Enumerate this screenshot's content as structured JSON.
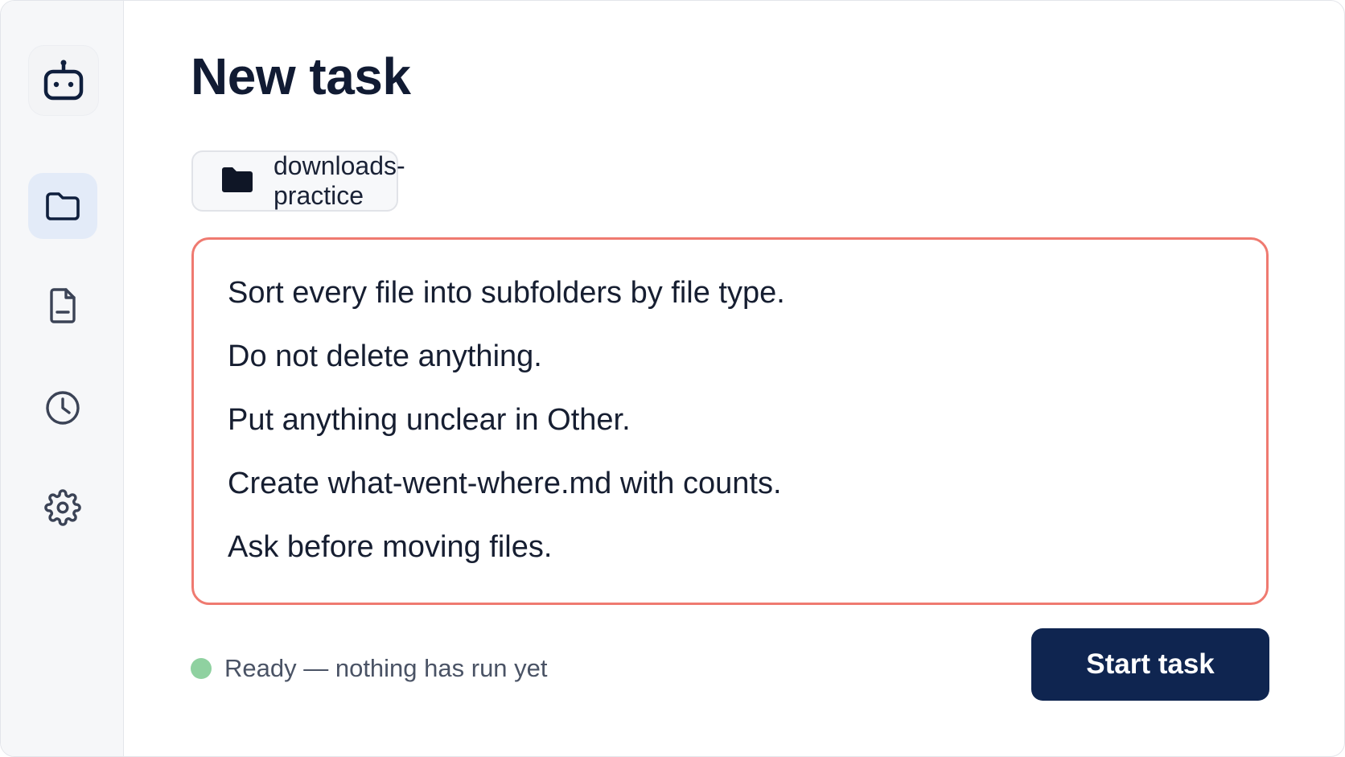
{
  "sidebar": {
    "logo_icon": "robot-icon",
    "items": [
      {
        "icon": "folder-icon",
        "active": true
      },
      {
        "icon": "document-icon",
        "active": false
      },
      {
        "icon": "clock-icon",
        "active": false
      },
      {
        "icon": "gear-icon",
        "active": false
      }
    ]
  },
  "main": {
    "title": "New task",
    "folder_chip": {
      "icon": "folder-filled-icon",
      "label": "downloads-practice"
    },
    "prompt_lines": [
      "Sort every file into subfolders by file type.",
      "Do not delete anything.",
      "Put anything unclear in Other.",
      "Create what-went-where.md with counts.",
      "Ask before moving files."
    ],
    "status": {
      "text": "Ready — nothing has run yet",
      "color": "#8fd1a0"
    },
    "start_button_label": "Start task"
  },
  "colors": {
    "accent": "#0f2550",
    "prompt_border": "#ef7a70",
    "active_nav_bg": "#e3ebf8",
    "title_text": "#111b33"
  }
}
